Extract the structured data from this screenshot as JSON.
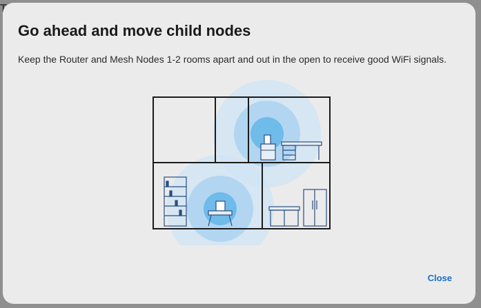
{
  "dialog": {
    "title": "Go ahead and move child nodes",
    "description": "Keep the Router and Mesh Nodes 1-2 rooms apart and out in the open to receive good WiFi signals.",
    "close_label": "Close"
  },
  "colors": {
    "accent": "#1a6fc9",
    "signal": "#5fb0e8",
    "node": "#2d7fd3",
    "wall": "#1a1a1a"
  }
}
